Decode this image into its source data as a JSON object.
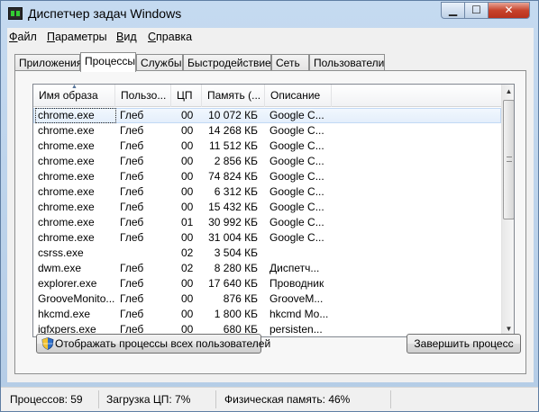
{
  "window": {
    "title": "Диспетчер задач Windows",
    "controls": {
      "minimize": "▁",
      "maximize": "☐",
      "close": "✕"
    }
  },
  "menu": [
    "Файл",
    "Параметры",
    "Вид",
    "Справка"
  ],
  "tabs": [
    "Приложения",
    "Процессы",
    "Службы",
    "Быстродействие",
    "Сеть",
    "Пользователи"
  ],
  "active_tab": "Процессы",
  "columns": [
    "Имя образа",
    "Пользо...",
    "ЦП",
    "Память (...",
    "Описание"
  ],
  "processes": [
    {
      "name": "chrome.exe",
      "user": "Глеб",
      "cpu": "00",
      "mem": "10 072 КБ",
      "desc": "Google C..."
    },
    {
      "name": "chrome.exe",
      "user": "Глеб",
      "cpu": "00",
      "mem": "14 268 КБ",
      "desc": "Google C..."
    },
    {
      "name": "chrome.exe",
      "user": "Глеб",
      "cpu": "00",
      "mem": "11 512 КБ",
      "desc": "Google C..."
    },
    {
      "name": "chrome.exe",
      "user": "Глеб",
      "cpu": "00",
      "mem": "2 856 КБ",
      "desc": "Google C..."
    },
    {
      "name": "chrome.exe",
      "user": "Глеб",
      "cpu": "00",
      "mem": "74 824 КБ",
      "desc": "Google C..."
    },
    {
      "name": "chrome.exe",
      "user": "Глеб",
      "cpu": "00",
      "mem": "6 312 КБ",
      "desc": "Google C..."
    },
    {
      "name": "chrome.exe",
      "user": "Глеб",
      "cpu": "00",
      "mem": "15 432 КБ",
      "desc": "Google C..."
    },
    {
      "name": "chrome.exe",
      "user": "Глеб",
      "cpu": "01",
      "mem": "30 992 КБ",
      "desc": "Google C..."
    },
    {
      "name": "chrome.exe",
      "user": "Глеб",
      "cpu": "00",
      "mem": "31 004 КБ",
      "desc": "Google C..."
    },
    {
      "name": "csrss.exe",
      "user": "",
      "cpu": "02",
      "mem": "3 504 КБ",
      "desc": ""
    },
    {
      "name": "dwm.exe",
      "user": "Глеб",
      "cpu": "02",
      "mem": "8 280 КБ",
      "desc": "Диспетч..."
    },
    {
      "name": "explorer.exe",
      "user": "Глеб",
      "cpu": "00",
      "mem": "17 640 КБ",
      "desc": "Проводник"
    },
    {
      "name": "GrooveMonito...",
      "user": "Глеб",
      "cpu": "00",
      "mem": "876 КБ",
      "desc": "GrooveM..."
    },
    {
      "name": "hkcmd.exe",
      "user": "Глеб",
      "cpu": "00",
      "mem": "1 800 КБ",
      "desc": "hkcmd Mo..."
    },
    {
      "name": "igfxpers.exe",
      "user": "Глеб",
      "cpu": "00",
      "mem": "680 КБ",
      "desc": "persisten..."
    }
  ],
  "buttons": {
    "show_all": "Отображать процессы всех пользователей",
    "end_process": "Завершить процесс"
  },
  "scrollbar": {
    "up": "▲",
    "down": "▼"
  },
  "status": {
    "processes": "Процессов: 59",
    "cpu": "Загрузка ЦП: 7%",
    "memory": "Физическая память: 46%"
  }
}
